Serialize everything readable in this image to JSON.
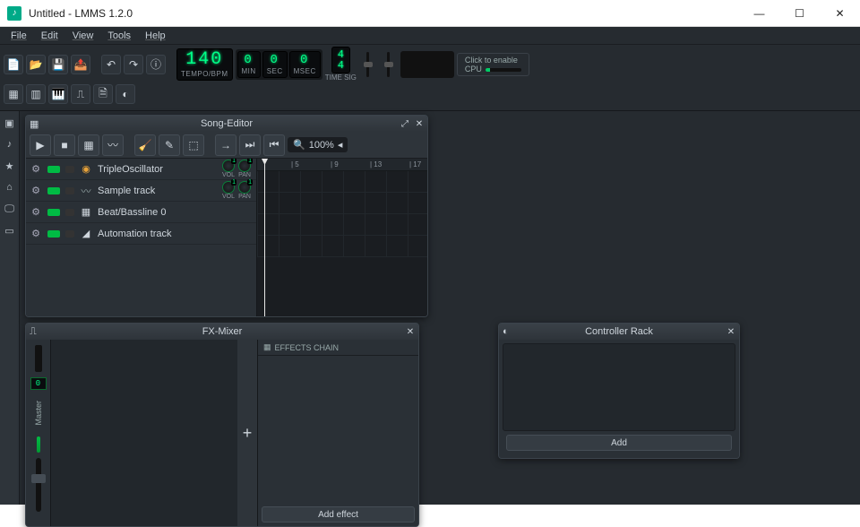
{
  "window": {
    "title": "Untitled - LMMS 1.2.0",
    "controls": {
      "min": "—",
      "max": "☐",
      "close": "✕"
    }
  },
  "menu": [
    "File",
    "Edit",
    "View",
    "Tools",
    "Help"
  ],
  "transport": {
    "tempo": "140",
    "tempo_label": "TEMPO/BPM",
    "min": "0",
    "sec": "0",
    "msec": "0",
    "min_label": "MIN",
    "sec_label": "SEC",
    "msec_label": "MSEC",
    "timesig_top": "4",
    "timesig_bot": "4",
    "timesig_label": "TIME SIG",
    "cpu_hint": "Click to enable",
    "cpu_label": "CPU"
  },
  "song_editor": {
    "title": "Song-Editor",
    "zoom": "100%",
    "ruler": [
      "| 5",
      "| 9",
      "| 13",
      "| 17"
    ],
    "tracks": [
      {
        "name": "TripleOscillator",
        "icon": "osc",
        "knobs": true,
        "vol_label": "VOL",
        "pan_label": "PAN"
      },
      {
        "name": "Sample track",
        "icon": "wave",
        "knobs": true,
        "vol_label": "VOL",
        "pan_label": "PAN"
      },
      {
        "name": "Beat/Bassline 0",
        "icon": "grid",
        "knobs": false
      },
      {
        "name": "Automation track",
        "icon": "ramp",
        "knobs": false
      }
    ]
  },
  "fx_mixer": {
    "title": "FX-Mixer",
    "master_label": "Master",
    "master_disp": "0",
    "chain_title": "EFFECTS CHAIN",
    "add_effect": "Add effect"
  },
  "controller_rack": {
    "title": "Controller Rack",
    "add": "Add"
  }
}
